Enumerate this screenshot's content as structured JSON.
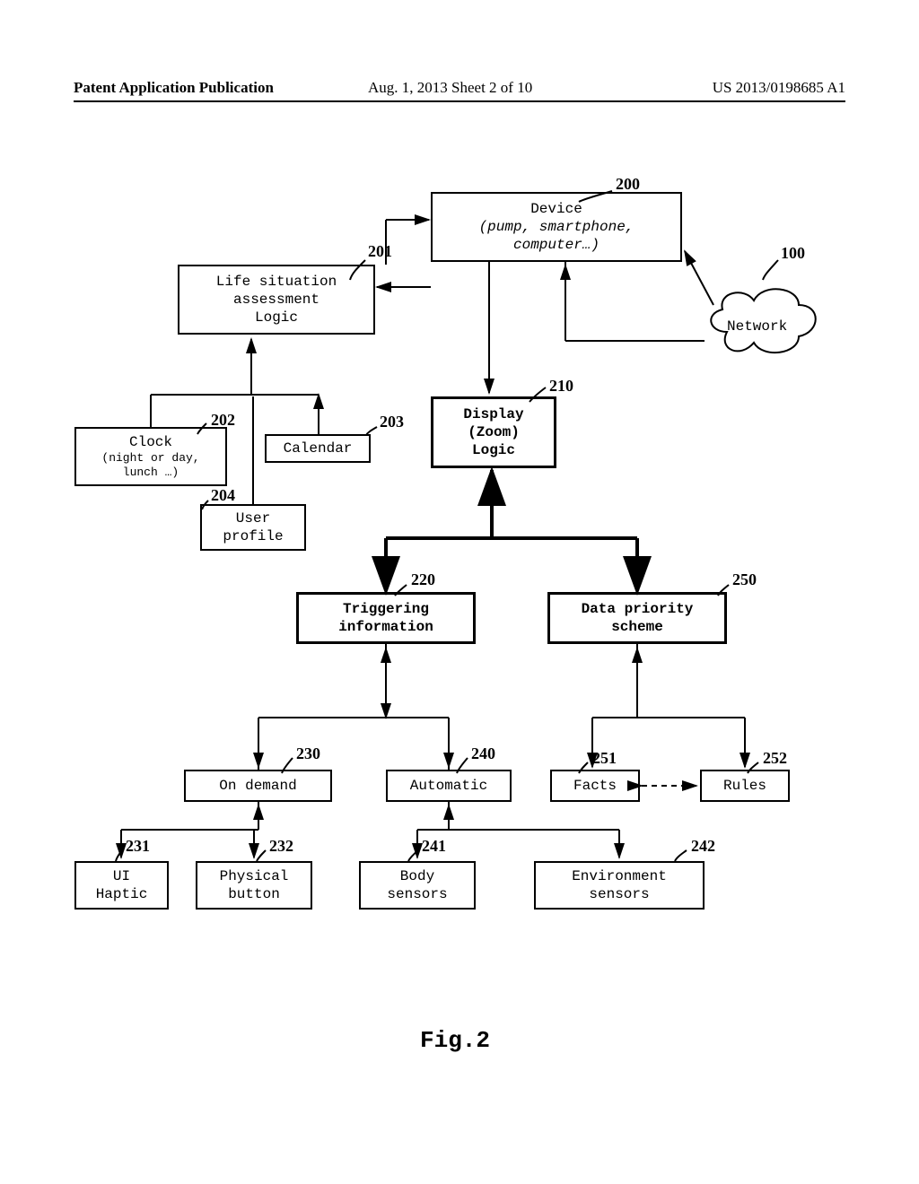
{
  "header": {
    "left": "Patent Application Publication",
    "center": "Aug. 1, 2013   Sheet 2 of 10",
    "right": "US 2013/0198685 A1"
  },
  "nodes": {
    "device": {
      "l1": "Device",
      "l2": "(pump, smartphone,",
      "l3": "computer…)"
    },
    "network": "Network",
    "life": {
      "l1": "Life situation",
      "l2": "assessment",
      "l3": "Logic"
    },
    "display": {
      "l1": "Display",
      "l2": "(Zoom)",
      "l3": "Logic"
    },
    "clock": {
      "l1": "Clock",
      "l2": "(night or day,",
      "l3": "lunch …)"
    },
    "calendar": "Calendar",
    "user_profile": {
      "l1": "User",
      "l2": "profile"
    },
    "triggering": {
      "l1": "Triggering",
      "l2": "information"
    },
    "data_priority": {
      "l1": "Data priority",
      "l2": "scheme"
    },
    "on_demand": "On demand",
    "automatic": "Automatic",
    "facts": "Facts",
    "rules": "Rules",
    "ui_haptic": {
      "l1": "UI",
      "l2": "Haptic"
    },
    "physical_button": {
      "l1": "Physical",
      "l2": "button"
    },
    "body_sensors": {
      "l1": "Body",
      "l2": "sensors"
    },
    "env_sensors": {
      "l1": "Environment",
      "l2": "sensors"
    }
  },
  "refs": {
    "r100": "100",
    "r200": "200",
    "r201": "201",
    "r202": "202",
    "r203": "203",
    "r204": "204",
    "r210": "210",
    "r220": "220",
    "r250": "250",
    "r230": "230",
    "r240": "240",
    "r251": "251",
    "r252": "252",
    "r231": "231",
    "r232": "232",
    "r241": "241",
    "r242": "242"
  },
  "figure_caption": "Fig.2"
}
